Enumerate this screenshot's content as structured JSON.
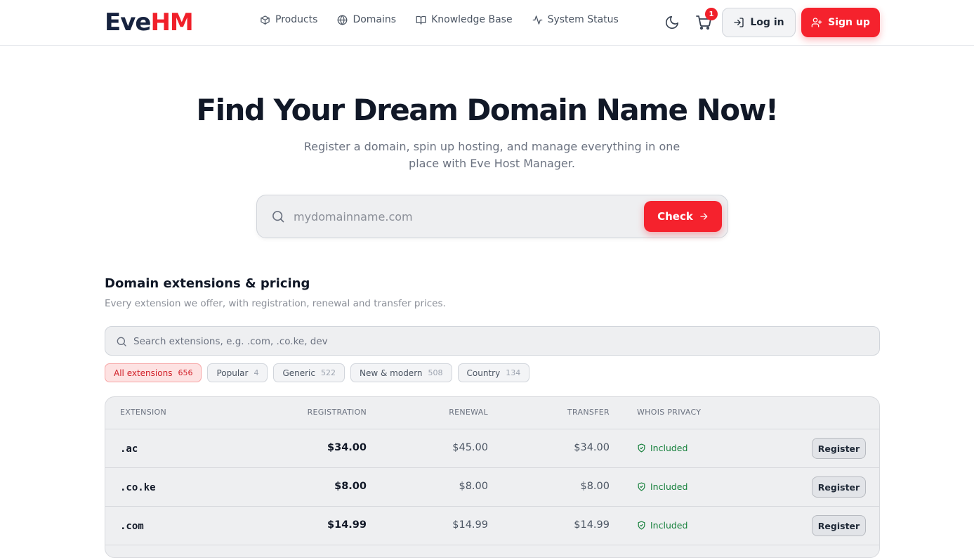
{
  "brand": {
    "part1": "Eve",
    "part2": "HM"
  },
  "nav": [
    {
      "label": "Products",
      "icon": "box-icon"
    },
    {
      "label": "Domains",
      "icon": "globe-icon"
    },
    {
      "label": "Knowledge Base",
      "icon": "book-icon"
    },
    {
      "label": "System Status",
      "icon": "activity-icon"
    }
  ],
  "header": {
    "cart_count": "1",
    "login_label": "Log in",
    "signup_label": "Sign up"
  },
  "hero": {
    "title": "Find Your Dream Domain Name Now!",
    "subtitle": "Register a domain, spin up hosting, and manage everything in one place with Eve Host Manager.",
    "search_placeholder": "mydomainname.com",
    "check_label": "Check"
  },
  "pricing": {
    "title": "Domain extensions & pricing",
    "subtitle": "Every extension we offer, with registration, renewal and transfer prices.",
    "search_placeholder": "Search extensions, e.g. .com, .co.ke, dev",
    "filters": [
      {
        "label": "All extensions",
        "count": "656",
        "active": true
      },
      {
        "label": "Popular",
        "count": "4",
        "active": false
      },
      {
        "label": "Generic",
        "count": "522",
        "active": false
      },
      {
        "label": "New & modern",
        "count": "508",
        "active": false
      },
      {
        "label": "Country",
        "count": "134",
        "active": false
      }
    ],
    "columns": {
      "extension": "EXTENSION",
      "registration": "REGISTRATION",
      "renewal": "RENEWAL",
      "transfer": "TRANSFER",
      "privacy": "WHOIS PRIVACY"
    },
    "rows": [
      {
        "ext": ".ac",
        "registration": "$34.00",
        "renewal": "$45.00",
        "transfer": "$34.00",
        "privacy": "Included",
        "action": "Register"
      },
      {
        "ext": ".co.ke",
        "registration": "$8.00",
        "renewal": "$8.00",
        "transfer": "$8.00",
        "privacy": "Included",
        "action": "Register"
      },
      {
        "ext": ".com",
        "registration": "$14.99",
        "renewal": "$14.99",
        "transfer": "$14.99",
        "privacy": "Included",
        "action": "Register"
      }
    ]
  },
  "colors": {
    "accent": "#f5222d",
    "brand_dark": "#17233f",
    "success": "#16803c"
  }
}
